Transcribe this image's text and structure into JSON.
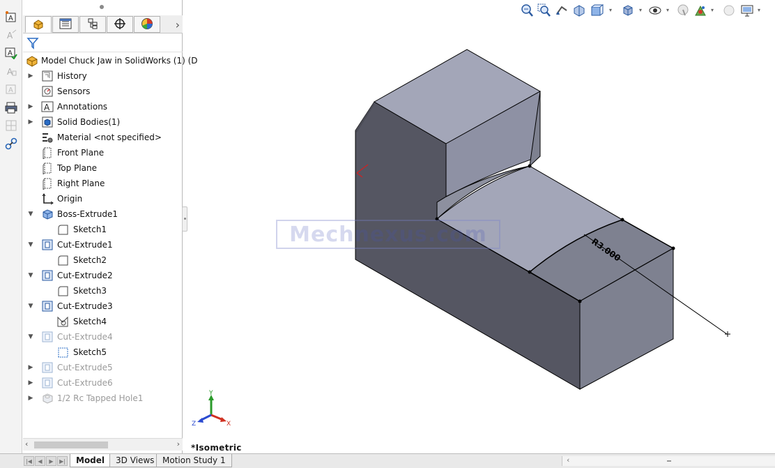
{
  "feature_manager": {
    "tabs": [
      {
        "icon": "feature-tree-icon"
      },
      {
        "icon": "property-manager-icon"
      },
      {
        "icon": "configuration-manager-icon"
      },
      {
        "icon": "dimxpert-icon"
      },
      {
        "icon": "display-manager-icon"
      }
    ],
    "tree": [
      {
        "label": "Model Chuck Jaw in SolidWorks (1)  (D",
        "icon": "part-icon"
      },
      {
        "label": "History",
        "icon": "history-icon"
      },
      {
        "label": "Sensors",
        "icon": "sensors-icon"
      },
      {
        "label": "Annotations",
        "icon": "annotations-icon"
      },
      {
        "label": "Solid Bodies(1)",
        "icon": "solid-bodies-icon"
      },
      {
        "label": "Material <not specified>",
        "icon": "material-icon"
      },
      {
        "label": "Front Plane",
        "icon": "plane-icon"
      },
      {
        "label": "Top Plane",
        "icon": "plane-icon"
      },
      {
        "label": "Right Plane",
        "icon": "plane-icon"
      },
      {
        "label": "Origin",
        "icon": "origin-icon"
      },
      {
        "label": "Boss-Extrude1",
        "icon": "boss-extrude-icon"
      },
      {
        "label": "Sketch1",
        "icon": "sketch-icon"
      },
      {
        "label": "Cut-Extrude1",
        "icon": "cut-extrude-icon"
      },
      {
        "label": "Sketch2",
        "icon": "sketch-icon"
      },
      {
        "label": "Cut-Extrude2",
        "icon": "cut-extrude-icon"
      },
      {
        "label": "Sketch3",
        "icon": "sketch-icon"
      },
      {
        "label": "Cut-Extrude3",
        "icon": "cut-extrude-icon"
      },
      {
        "label": "Sketch4",
        "icon": "sketch-icon"
      },
      {
        "label": "Cut-Extrude4",
        "icon": "cut-extrude-icon"
      },
      {
        "label": "Sketch5",
        "icon": "sketch-icon"
      },
      {
        "label": "Cut-Extrude5",
        "icon": "cut-extrude-icon"
      },
      {
        "label": "Cut-Extrude6",
        "icon": "cut-extrude-icon"
      },
      {
        "label": "1/2 Rc Tapped Hole1",
        "icon": "hole-wizard-icon"
      }
    ]
  },
  "view_toolbar": [
    "zoom-to-fit-icon",
    "zoom-to-area-icon",
    "previous-view-icon",
    "section-view-icon",
    "view-orientation-icon",
    "display-style-icon",
    "hide-show-items-icon",
    "edit-appearance-icon",
    "apply-scene-icon",
    "view-settings-icon",
    "monitor-icon"
  ],
  "viewport": {
    "view_name": "*Isometric",
    "dimension_label": "R3.000",
    "watermark": "Mechnexus.com",
    "triad": {
      "x": "X",
      "y": "Y",
      "z": "Z"
    }
  },
  "bottom_tabs": [
    "Model",
    "3D Views",
    "Motion Study 1"
  ],
  "colors": {
    "face_top": "#a3a6b8",
    "face_front": "#7e8190",
    "face_side": "#555662",
    "edge": "#000000"
  }
}
